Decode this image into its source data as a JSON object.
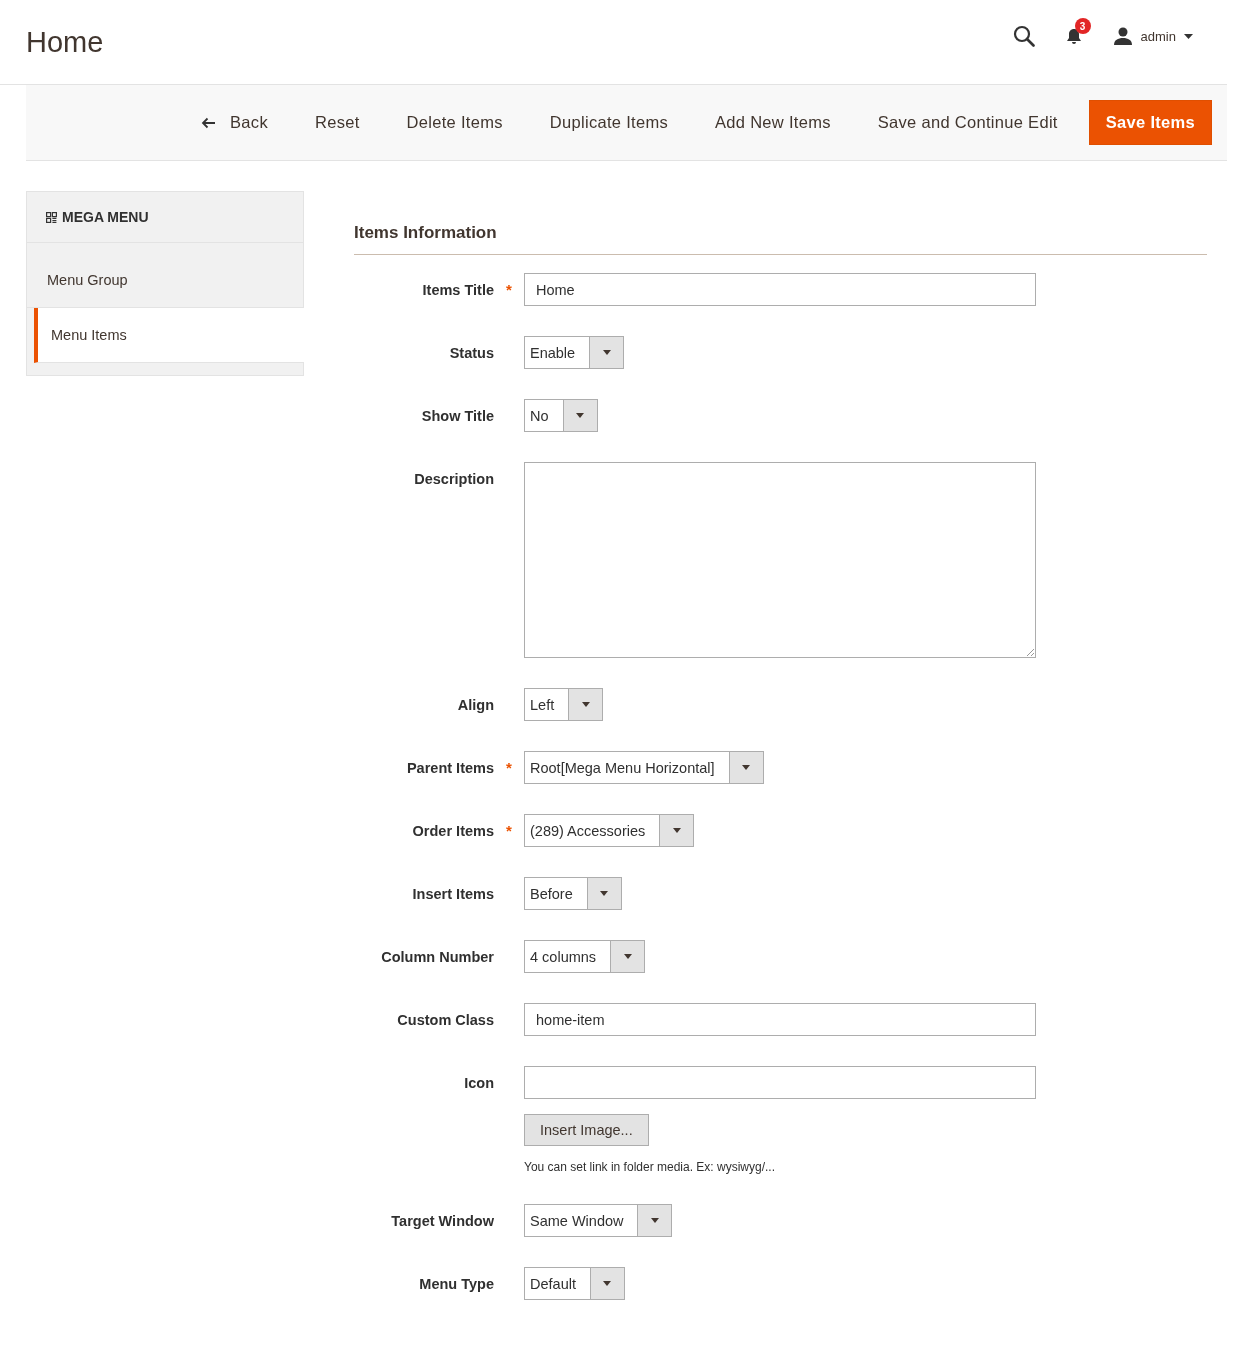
{
  "page_title": "Home",
  "header": {
    "notification_count": "3",
    "user": "admin"
  },
  "toolbar": {
    "buttons": [
      {
        "label": "Back",
        "kind": "back"
      },
      {
        "label": "Reset",
        "kind": "plain"
      },
      {
        "label": "Delete Items",
        "kind": "plain"
      },
      {
        "label": "Duplicate Items",
        "kind": "plain"
      },
      {
        "label": "Add New Items",
        "kind": "plain"
      },
      {
        "label": "Save and Continue Edit",
        "kind": "plain"
      },
      {
        "label": "Save Items",
        "kind": "primary"
      }
    ]
  },
  "sidebar": {
    "title": "MEGA MENU",
    "items": [
      {
        "label": "Menu Group",
        "selected": false
      },
      {
        "label": "Menu Items",
        "selected": true
      }
    ]
  },
  "section_title": "Items Information",
  "fields": [
    {
      "label": "Items Title",
      "required_mark": "*",
      "kind": "text",
      "value": "Home"
    },
    {
      "label": "Status",
      "kind": "select",
      "value": "Enable"
    },
    {
      "label": "Show Title",
      "kind": "select",
      "value": "No"
    },
    {
      "label": "Description",
      "kind": "textarea"
    },
    {
      "label": "Align",
      "kind": "select",
      "value": "Left"
    },
    {
      "label": "Parent Items",
      "required_mark": "*",
      "kind": "select",
      "value": "Root[Mega Menu Horizontal]"
    },
    {
      "label": "Order Items",
      "required_mark": "*",
      "kind": "select",
      "value": "(289) Accessories"
    },
    {
      "label": "Insert Items",
      "kind": "select",
      "value": "Before"
    },
    {
      "label": "Column Number",
      "kind": "select",
      "value": "4 columns"
    },
    {
      "label": "Custom Class",
      "kind": "text",
      "value": "home-item"
    },
    {
      "label": "Icon",
      "kind": "text",
      "button": "Insert Image...",
      "note": "You can set link in folder media. Ex: wysiwyg/..."
    },
    {
      "label": "Target Window",
      "kind": "select",
      "value": "Same Window"
    },
    {
      "label": "Menu Type",
      "kind": "select",
      "value": "Default"
    }
  ]
}
